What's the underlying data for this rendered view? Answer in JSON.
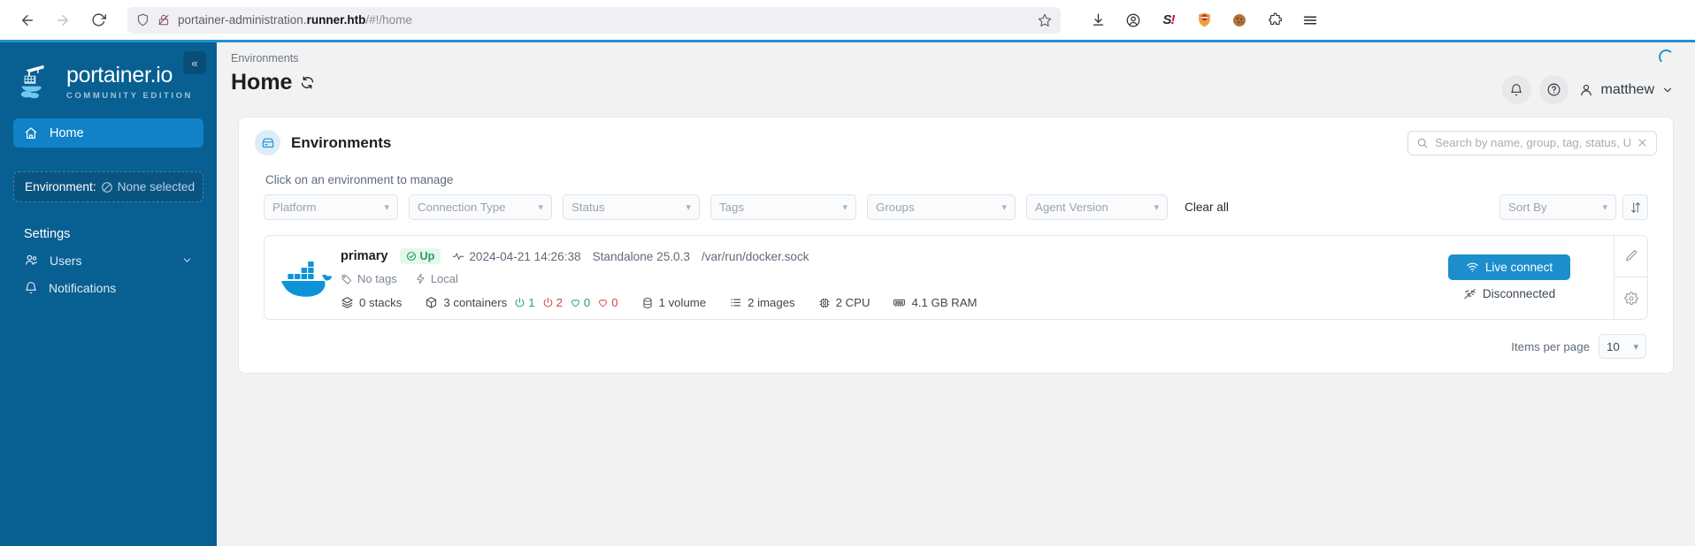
{
  "browser": {
    "back_label": "Back",
    "forward_label": "Forward",
    "reload_label": "Reload",
    "url_prefix": "portainer-administration.",
    "url_host_bold": "runner.htb",
    "url_path": "/#!/home",
    "bookmark_label": "Bookmark this page",
    "extensions": [
      {
        "name": "downloads-icon",
        "glyph": "↓"
      },
      {
        "name": "account-icon",
        "glyph": "ⓘ"
      },
      {
        "name": "shodan-icon",
        "glyph": "S!"
      },
      {
        "name": "ublock-icon",
        "glyph": "⛔"
      },
      {
        "name": "cookie-manager-icon",
        "glyph": "🍪"
      },
      {
        "name": "extensions-puzzle-icon",
        "glyph": "🧩"
      },
      {
        "name": "app-menu-icon",
        "glyph": "☰"
      }
    ]
  },
  "sidebar": {
    "logo_title": "portainer.io",
    "logo_subtitle": "COMMUNITY EDITION",
    "collapse_label": "«",
    "home_label": "Home",
    "environment_label": "Environment:",
    "environment_value": "None selected",
    "settings_section": "Settings",
    "users_label": "Users",
    "notifications_label": "Notifications"
  },
  "header": {
    "breadcrumb": "Environments",
    "title": "Home",
    "user_name": "matthew"
  },
  "card": {
    "title": "Environments",
    "search_placeholder": "Search by name, group, tag, status, URL...",
    "search_value": "",
    "hint": "Click on an environment to manage",
    "filters": [
      {
        "label": "Platform"
      },
      {
        "label": "Connection Type"
      },
      {
        "label": "Status"
      },
      {
        "label": "Tags"
      },
      {
        "label": "Groups"
      },
      {
        "label": "Agent Version"
      }
    ],
    "clear_all": "Clear all",
    "sort_by": "Sort By",
    "items_per_page_label": "Items per page",
    "items_per_page_value": "10"
  },
  "environment": {
    "name": "primary",
    "status": "Up",
    "heartbeat": "2024-04-21 14:26:38",
    "type": "Standalone 25.0.3",
    "url": "/var/run/docker.sock",
    "tags": "No tags",
    "connection": "Local",
    "stacks": "0 stacks",
    "containers": "3 containers",
    "containers_running": "1",
    "containers_stopped": "2",
    "containers_healthy": "0",
    "containers_unhealthy": "0",
    "volumes": "1 volume",
    "images": "2 images",
    "cpu": "2 CPU",
    "ram": "4.1 GB RAM",
    "live_connect": "Live connect",
    "connection_state": "Disconnected",
    "edit_label": "Edit environment",
    "settings_label": "Environment settings"
  },
  "colors": {
    "brand_blue": "#1b8ecb",
    "sidebar_blue": "#075f92",
    "status_green": "#2a9d5c",
    "status_red": "#d04545"
  }
}
